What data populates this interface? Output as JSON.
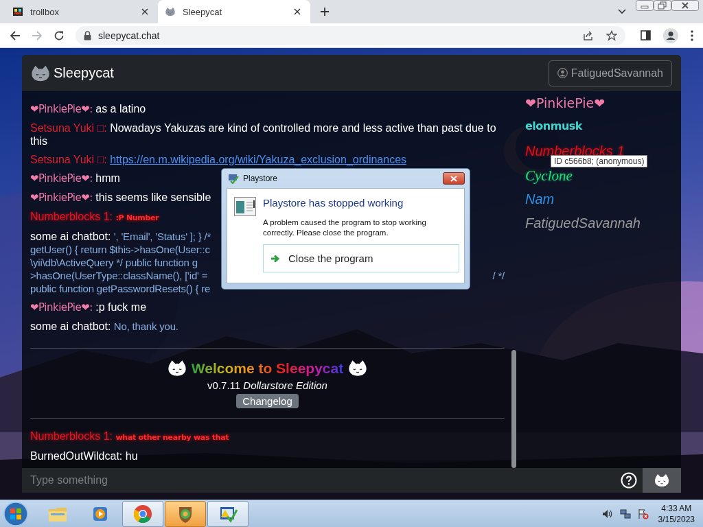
{
  "browser": {
    "tabs": [
      {
        "title": "trollbox",
        "selected": false
      },
      {
        "title": "Sleepycat",
        "selected": true
      }
    ],
    "url": "sleepycat.chat",
    "forward_disabled": true
  },
  "app": {
    "title": "Sleepycat",
    "user": "FatiguedSavannah"
  },
  "messages": [
    {
      "name": "❤PinkiePie❤:",
      "color": "#f07aa8",
      "kind": "script",
      "text": "as a latino"
    },
    {
      "name": "Setsuna Yuki □:",
      "color": "#e0202a",
      "kind": "plain",
      "lines": [
        {
          "text": "Nowadays Yakuzas are kind of controlled more and less active than past due to"
        },
        {
          "text": "this"
        }
      ]
    },
    {
      "name": "Setsuna Yuki □:",
      "color": "#e0202a",
      "kind": "link",
      "text": "https://en.m.wikipedia.org/wiki/Yakuza_exclusion_ordinances"
    },
    {
      "name": "❤PinkiePie❤:",
      "color": "#f07aa8",
      "kind": "script",
      "text": "hmm"
    },
    {
      "name": "❤PinkiePie❤:",
      "color": "#f07aa8",
      "kind": "script",
      "text": "this seems like sensible"
    },
    {
      "name": "Numberblocks 1:",
      "color": "#e5141e",
      "kind": "glow",
      "text": ":P Number"
    },
    {
      "name": "some ai chatbot:",
      "color": "#ffffff",
      "kind": "code",
      "lines": [
        {
          "text": "', 'Email', 'Status' ]; } /*"
        },
        {
          "text": "getUser() { return $this->hasOne(User::c"
        },
        {
          "text": "\\yii\\db\\ActiveQuery */ public function g"
        },
        {
          "text": ">hasOne(UserType::className(), ['id' =",
          "tail": "/ */"
        },
        {
          "text": "public function getPasswordResets() { re"
        }
      ]
    },
    {
      "name": "❤PinkiePie❤:",
      "color": "#f07aa8",
      "kind": "script",
      "text": ":p fuck me"
    },
    {
      "name": "some ai chatbot:",
      "color": "#ffffff",
      "kind": "code",
      "text": "No, thank you."
    }
  ],
  "welcome": {
    "title": "Welcome to Sleepycat",
    "version": "v0.7.11 *Dollarstore Edition*",
    "button": "Changelog"
  },
  "recent_messages": [
    {
      "name": "Numberblocks 1:",
      "color": "#e5141e",
      "kind": "glow",
      "text": "what other nearby was that"
    },
    {
      "name": "BurnedOutWildcat:",
      "color": "#ffffff",
      "kind": "plain",
      "text": "hu"
    }
  ],
  "users": [
    {
      "name": "❤PinkiePie❤",
      "color": "#f07aa8",
      "kind": "script"
    },
    {
      "name": "elonmusk",
      "color": "#3fd6d0",
      "kind": "heavy"
    },
    {
      "name": "Numberblocks 1",
      "color": "#d8101a",
      "kind": "glow",
      "tooltip": "ID c566b8; (anonymous)"
    },
    {
      "name": "Cyclone",
      "color": "#22e07a",
      "kind": "serif"
    },
    {
      "name": "Nam",
      "color": "#2f8fe0",
      "kind": "italic"
    },
    {
      "name": "FatiguedSavannah",
      "color": "#9a9a9a",
      "kind": "italic"
    }
  ],
  "input": {
    "placeholder": "Type something"
  },
  "dialog": {
    "title": "Playstore",
    "heading": "Playstore has stopped working",
    "message": "A problem caused the program to stop working correctly. Please close the program.",
    "action": "Close the program"
  },
  "taskbar": {
    "apps": [
      {
        "kind": "explorer",
        "open": false,
        "attention": false
      },
      {
        "kind": "media",
        "open": false,
        "attention": false
      },
      {
        "kind": "chrome",
        "open": true,
        "attention": false
      },
      {
        "kind": "game",
        "open": true,
        "attention": true
      },
      {
        "kind": "checklist",
        "open": true,
        "attention": false
      }
    ],
    "time": "4:33 AM",
    "date": "3/15/2023"
  }
}
